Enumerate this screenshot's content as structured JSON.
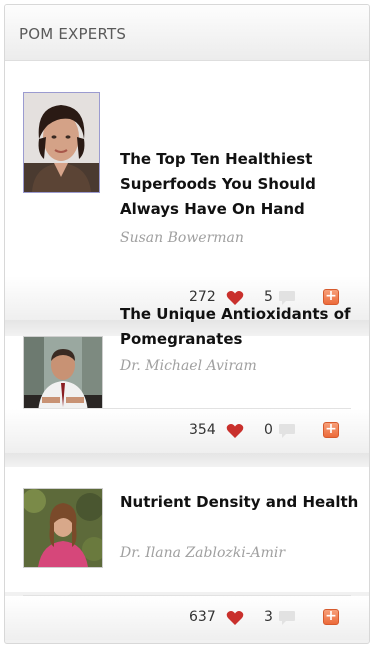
{
  "header": {
    "title": "POM EXPERTS"
  },
  "articles": [
    {
      "title": "The Top Ten Healthiest Superfoods You Should Always Have On Hand",
      "author": "Susan Bowerman",
      "likes": "272",
      "comments": "5"
    },
    {
      "title": "The Unique Antioxidants of Pomegranates",
      "author": "Dr. Michael Aviram",
      "likes": "354",
      "comments": "0"
    },
    {
      "title": "Nutrient Density and Health",
      "author": "Dr. Ilana Zablozki-Amir",
      "likes": "637",
      "comments": "3"
    }
  ],
  "colors": {
    "heart": "#c9302c",
    "plus": "#ec6a3a",
    "header_text": "#5a5a5a"
  }
}
